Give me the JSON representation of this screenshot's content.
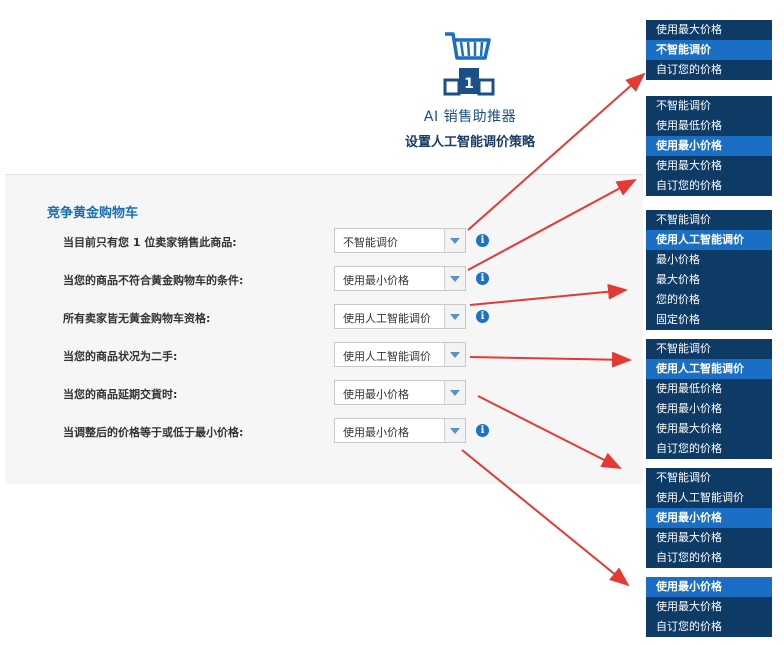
{
  "header": {
    "title": "AI 销售助推器",
    "subtitle": "设置人工智能调价策略",
    "logo_icon": "shopping-cart-podium-icon",
    "logo_digit": "1"
  },
  "section": {
    "title": "竞争黄金购物车",
    "rows": [
      {
        "label": "当目前只有您 1 位卖家销售此商品:",
        "value": "不智能调价",
        "info": true
      },
      {
        "label": "当您的商品不符合黄金购物车的条件:",
        "value": "使用最小价格",
        "info": true
      },
      {
        "label": "所有卖家皆无黄金购物车资格:",
        "value": "使用人工智能调价",
        "info": true
      },
      {
        "label": "当您的商品状况为二手:",
        "value": "使用人工智能调价",
        "info": false
      },
      {
        "label": "当您的商品延期交貨时:",
        "value": "使用最小价格",
        "info": false
      },
      {
        "label": "当调整后的价格等于或低于最小价格:",
        "value": "使用最小价格",
        "info": true
      }
    ]
  },
  "info_glyph": "i",
  "menus": [
    {
      "items": [
        "使用最大价格",
        "不智能调价",
        "自订您的价格"
      ],
      "selected": 1
    },
    {
      "items": [
        "不智能调价",
        "使用最低价格",
        "使用最小价格",
        "使用最大价格",
        "自订您的价格"
      ],
      "selected": 2
    },
    {
      "items": [
        "不智能调价",
        "使用人工智能调价",
        "最小价格",
        "最大价格",
        "您的价格",
        "固定价格"
      ],
      "selected": 1
    },
    {
      "items": [
        "不智能调价",
        "使用人工智能调价",
        "使用最低价格",
        "使用最小价格",
        "使用最大价格",
        "自订您的价格"
      ],
      "selected": 1
    },
    {
      "items": [
        "不智能调价",
        "使用人工智能调价",
        "使用最小价格",
        "使用最大价格",
        "自订您的价格"
      ],
      "selected": 2
    },
    {
      "items": [
        "使用最小价格",
        "使用最大价格",
        "自订您的价格"
      ],
      "selected": 0
    }
  ],
  "colors": {
    "accent": "#1a6fb0",
    "menu_bg": "#0e3a66",
    "menu_selected": "#1a6fc4",
    "arrow": "#e53935"
  }
}
